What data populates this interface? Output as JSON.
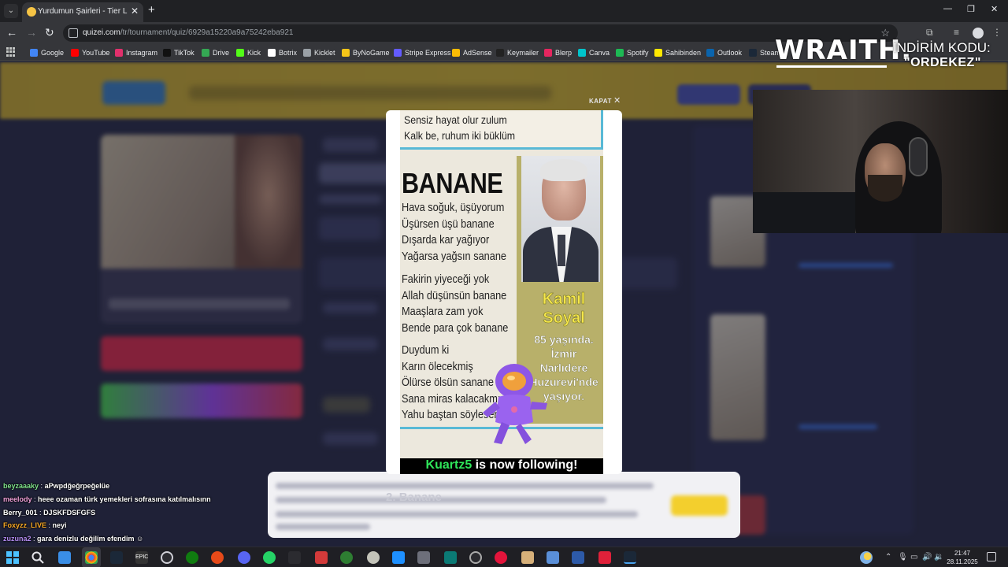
{
  "browser": {
    "tab_title": "Yurdumun Şairleri - Tier List | K",
    "url_host": "quizei.com",
    "url_path": "/tr/tournament/quiz/6929a15220a9a75242eba921",
    "bookmarks": [
      {
        "label": "Google",
        "color": "#4285f4"
      },
      {
        "label": "YouTube",
        "color": "#ff0000"
      },
      {
        "label": "Instagram",
        "color": "#e1306c"
      },
      {
        "label": "TikTok",
        "color": "#111111"
      },
      {
        "label": "Drive",
        "color": "#34a853"
      },
      {
        "label": "Kick",
        "color": "#53fc18"
      },
      {
        "label": "Botrix",
        "color": "#ffffff"
      },
      {
        "label": "Kicklet",
        "color": "#9aa0a6"
      },
      {
        "label": "ByNoGame",
        "color": "#f5c518"
      },
      {
        "label": "Stripe Express",
        "color": "#635bff"
      },
      {
        "label": "AdSense",
        "color": "#fbbc04"
      },
      {
        "label": "Keymailer",
        "color": "#222222"
      },
      {
        "label": "Blerp",
        "color": "#e5265f"
      },
      {
        "label": "Canva",
        "color": "#00c4cc"
      },
      {
        "label": "Spotify",
        "color": "#1db954"
      },
      {
        "label": "Sahibinden",
        "color": "#ffe800"
      },
      {
        "label": "Outlook",
        "color": "#0a64ad"
      },
      {
        "label": "Steam",
        "color": "#1b2838"
      }
    ]
  },
  "modal": {
    "close_label": "KAPAT",
    "clip_top_lines": [
      "Sensiz hayat olur zulum",
      "Kalk be, ruhum iki büklüm"
    ],
    "poem_title": "BANANE",
    "stanza1": [
      "Hava soğuk, üşüyorum",
      "Üşürsen üşü banane",
      "Dışarda kar yağıyor",
      "Yağarsa yağsın sanane"
    ],
    "stanza2": [
      "Fakirin yiyeceği yok",
      "Allah düşünsün banane",
      "Maaşlara zam yok",
      "Bende para çok banane"
    ],
    "stanza3": [
      "Duydum ki",
      "Karın ölecekmiş",
      "Ölürse ölsün sanane",
      "Sana miras kalacakmış",
      "Yahu baştan söylesene"
    ],
    "poet_name_1": "Kamil",
    "poet_name_2": "Soyal",
    "poet_info": [
      "85 yaşında.",
      "İzmir",
      "Narlıdere",
      "Huzurevi'nde",
      "yaşıyor."
    ]
  },
  "follow_alert": {
    "user": "Kuartz5",
    "text": " is now following!"
  },
  "caption": {
    "index": "2.",
    "title": "Banane"
  },
  "overlay": {
    "brand": "WRAITH.",
    "promo_label": "İNDİRİM KODU:",
    "promo_code": "\"ORDEKEZ\""
  },
  "chat": [
    {
      "user": "beyzaaaky",
      "message": "aPwpdğeğrpeğelüe",
      "color": "#7fe28a"
    },
    {
      "user": "meelody",
      "message": "heee ozaman türk yemekleri sofrasına katılmalısınn",
      "color": "#f0a0d8"
    },
    {
      "user": "Berry_001",
      "message": "DJSKFDSFGFS",
      "color": "#ffffff"
    },
    {
      "user": "Foxyzz_LIVE",
      "message": "neyi",
      "color": "#f5a623"
    },
    {
      "user": "zuzuna2",
      "message": "gara denizlu değilim efendim ☺",
      "color": "#b48cf2"
    }
  ],
  "taskbar": {
    "time": "21:47",
    "date": "28.11.2025"
  }
}
